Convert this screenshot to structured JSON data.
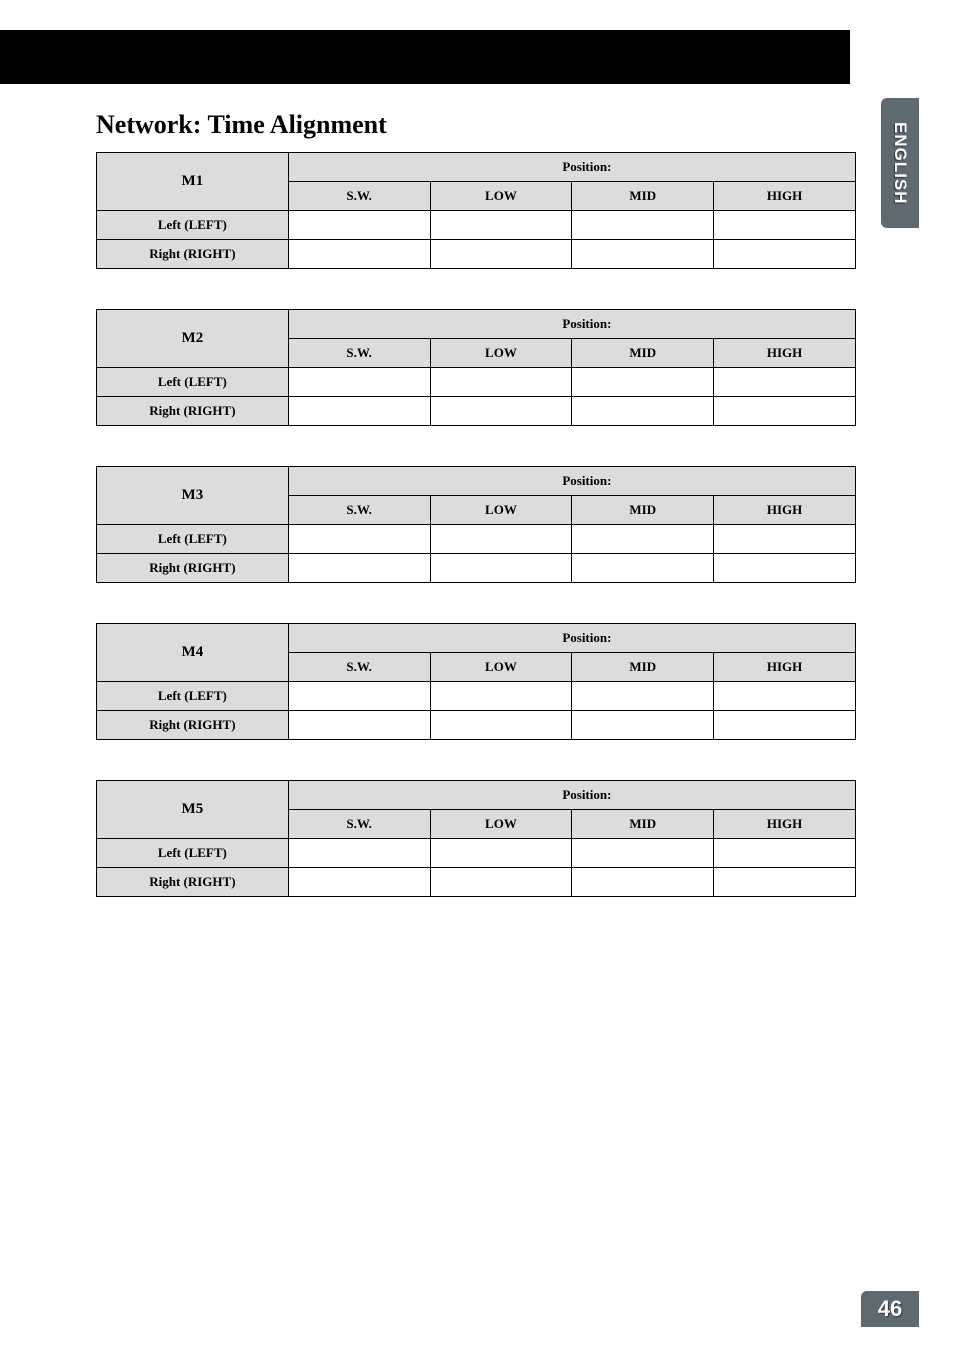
{
  "section_title": "Network: Time Alignment",
  "side_tab": "ENGLISH",
  "page_number": "46",
  "tables": [
    {
      "m_label": "M1",
      "position_label": "Position:",
      "cols": [
        "S.W.",
        "LOW",
        "MID",
        "HIGH"
      ],
      "rows": [
        {
          "label": "Left (LEFT)",
          "cells": [
            "",
            "",
            "",
            ""
          ]
        },
        {
          "label": "Right (RIGHT)",
          "cells": [
            "",
            "",
            "",
            ""
          ]
        }
      ]
    },
    {
      "m_label": "M2",
      "position_label": "Position:",
      "cols": [
        "S.W.",
        "LOW",
        "MID",
        "HIGH"
      ],
      "rows": [
        {
          "label": "Left (LEFT)",
          "cells": [
            "",
            "",
            "",
            ""
          ]
        },
        {
          "label": "Right (RIGHT)",
          "cells": [
            "",
            "",
            "",
            ""
          ]
        }
      ]
    },
    {
      "m_label": "M3",
      "position_label": "Position:",
      "cols": [
        "S.W.",
        "LOW",
        "MID",
        "HIGH"
      ],
      "rows": [
        {
          "label": "Left (LEFT)",
          "cells": [
            "",
            "",
            "",
            ""
          ]
        },
        {
          "label": "Right (RIGHT)",
          "cells": [
            "",
            "",
            "",
            ""
          ]
        }
      ]
    },
    {
      "m_label": "M4",
      "position_label": "Position:",
      "cols": [
        "S.W.",
        "LOW",
        "MID",
        "HIGH"
      ],
      "rows": [
        {
          "label": "Left (LEFT)",
          "cells": [
            "",
            "",
            "",
            ""
          ]
        },
        {
          "label": "Right (RIGHT)",
          "cells": [
            "",
            "",
            "",
            ""
          ]
        }
      ]
    },
    {
      "m_label": "M5",
      "position_label": "Position:",
      "cols": [
        "S.W.",
        "LOW",
        "MID",
        "HIGH"
      ],
      "rows": [
        {
          "label": "Left (LEFT)",
          "cells": [
            "",
            "",
            "",
            ""
          ]
        },
        {
          "label": "Right (RIGHT)",
          "cells": [
            "",
            "",
            "",
            ""
          ]
        }
      ]
    }
  ]
}
